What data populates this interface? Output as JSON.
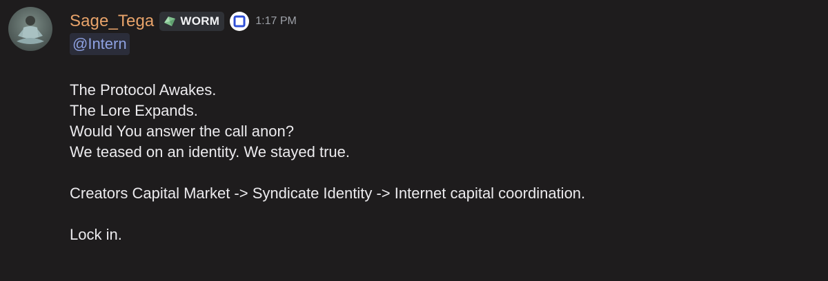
{
  "message": {
    "author": "Sage_Tega",
    "role_tag": {
      "label": "WORM",
      "icon": "gem-icon"
    },
    "badge_icon": "square-logo-icon",
    "timestamp": "1:17 PM",
    "mention": "@Intern",
    "lines": [
      "The Protocol Awakes.",
      "The Lore Expands.",
      "Would You answer the call anon?",
      "We teased on an identity. We stayed true.",
      "",
      "Creators Capital Market -> Syndicate Identity -> Internet capital coordination.",
      "",
      "Lock in."
    ]
  },
  "colors": {
    "background": "#1e1c1d",
    "username": "#e8a36a",
    "mention_text": "#8ea1e1",
    "timestamp": "#9ea1a8"
  }
}
